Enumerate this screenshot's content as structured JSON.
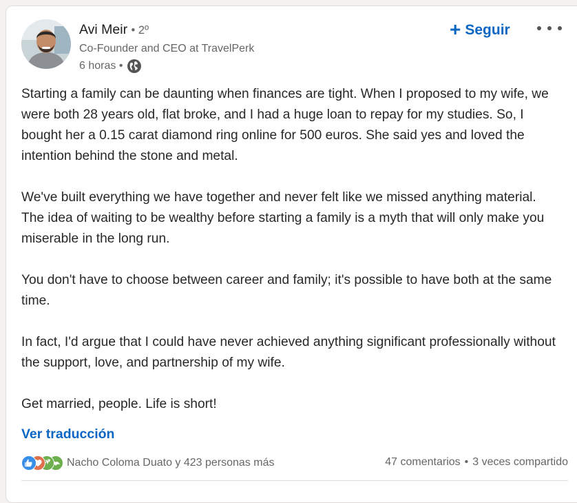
{
  "author": {
    "name": "Avi Meir",
    "degree": "• 2º",
    "headline": "Co-Founder and CEO at TravelPerk",
    "time": "6 horas •"
  },
  "actions": {
    "follow_icon": "+",
    "follow_label": "Seguir",
    "more_icon": "more-horizontal-icon"
  },
  "post": {
    "paragraphs": [
      "Starting a family can be daunting when finances are tight. When I proposed to my wife, we were both 28 years old, flat broke, and I had a huge loan to repay for my studies. So, I bought her a 0.15 carat diamond ring online for 500 euros. She said yes and loved the intention behind the stone and metal.",
      "We've built everything we have together and never felt like we missed anything material. The idea of waiting to be wealthy before starting a family is a myth that will only make you miserable in the long run.",
      "You don't have to choose between career and family; it's possible to have both at the same time.",
      "In fact, I'd argue that I could have never achieved anything significant professionally without the support, love, and partnership of my wife.",
      "Get married, people. Life is short!"
    ],
    "translate_label": "Ver traducción"
  },
  "social": {
    "reaction_icons": [
      "like-icon",
      "love-icon",
      "celebrate-icon",
      "support-icon"
    ],
    "reactions_text": "Nacho Coloma Duato y 423 personas más",
    "comments": "47 comentarios",
    "separator": "•",
    "shares": "3 veces compartido"
  },
  "colors": {
    "accent": "#0a66c2",
    "like": "#378fe9",
    "love": "#df704d",
    "celebrate": "#6dae4f"
  }
}
